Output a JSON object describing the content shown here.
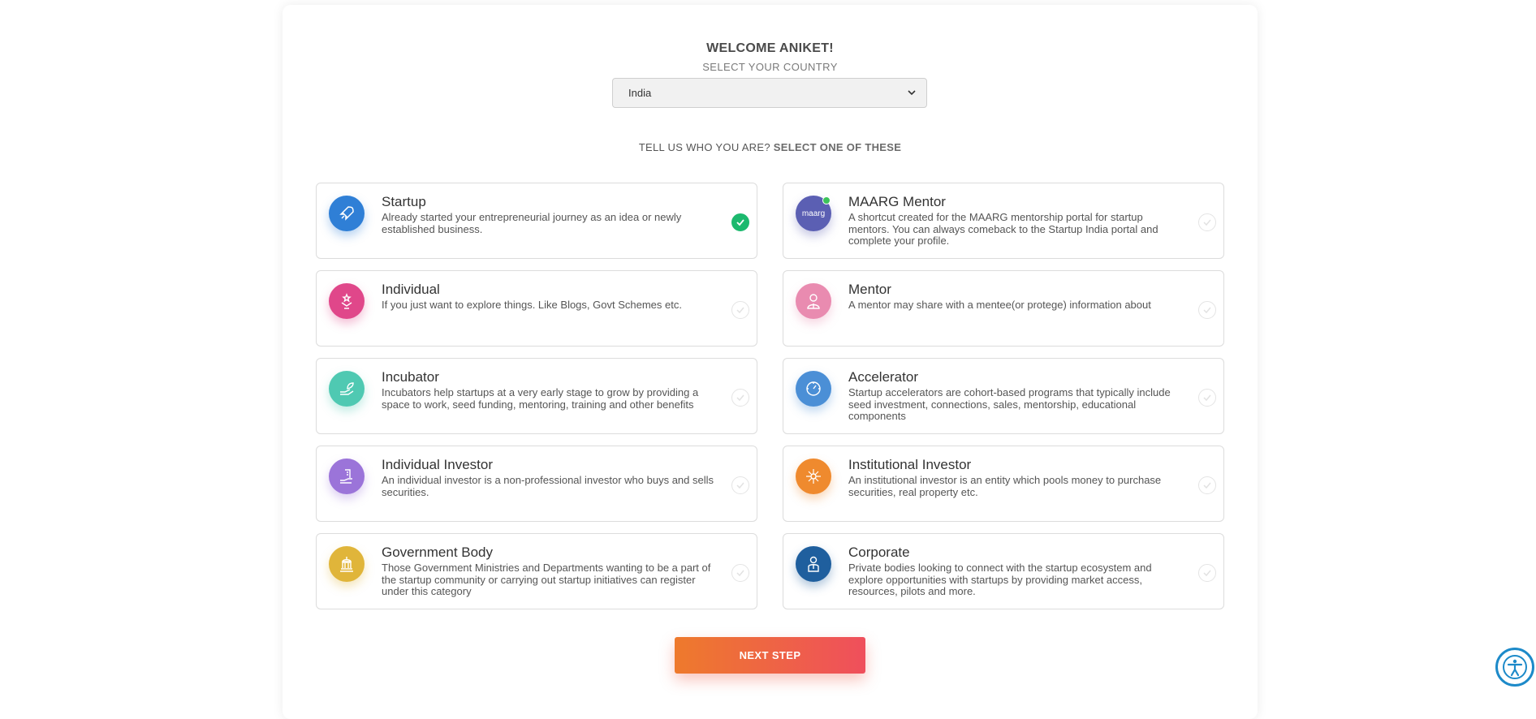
{
  "header": {
    "welcome": "WELCOME ANIKET!",
    "select_country": "SELECT YOUR COUNTRY"
  },
  "country": {
    "value": "India"
  },
  "prompt": {
    "lead": "TELL US WHO YOU ARE?",
    "emphasis": "SELECT ONE OF THESE"
  },
  "options": [
    {
      "title": "Startup",
      "desc": "Already started your entrepreneurial journey as an idea or newly established business.",
      "icon": "rocket-icon",
      "color": "#2f7fd6",
      "selected": true
    },
    {
      "title": "MAARG Mentor",
      "desc": "A shortcut created for the MAARG mentorship portal for startup mentors. You can always comeback to the Startup India portal and complete your profile.",
      "icon": "maarg-logo",
      "logo_text": "maarg",
      "color": "#5b5fb3",
      "selected": false
    },
    {
      "title": "Individual",
      "desc": "If you just want to explore things. Like Blogs, Govt Schemes etc.",
      "icon": "person-star-icon",
      "color": "#e0478a",
      "selected": false
    },
    {
      "title": "Mentor",
      "desc": "A mentor may share with a mentee(or protege) information about",
      "icon": "mentor-icon",
      "color": "#e98bb0",
      "selected": false
    },
    {
      "title": "Incubator",
      "desc": "Incubators help startups at a very early stage to grow by providing a space to work, seed funding, mentoring, training and other benefits",
      "icon": "plant-hand-icon",
      "color": "#4fc9b2",
      "selected": false
    },
    {
      "title": "Accelerator",
      "desc": "Startup accelerators are cohort-based programs that typically include seed investment, connections, sales, mentorship, educational components",
      "icon": "speedometer-icon",
      "color": "#4b8fd6",
      "selected": false
    },
    {
      "title": "Individual Investor",
      "desc": "An individual investor is a non-professional investor who buys and sells securities.",
      "icon": "hand-building-icon",
      "color": "#9b74d9",
      "selected": false
    },
    {
      "title": "Institutional Investor",
      "desc": "An institutional investor is an entity which pools money to purchase securities, real property etc.",
      "icon": "network-icon",
      "color": "#ef8a2e",
      "selected": false
    },
    {
      "title": "Government Body",
      "desc": "Those Government Ministries and Departments wanting to be a part of the startup community or carrying out startup initiatives can register under this category",
      "icon": "government-building-icon",
      "color": "#e0b53a",
      "selected": false
    },
    {
      "title": "Corporate",
      "desc": "Private bodies looking to connect with the startup ecosystem and explore opportunities with startups by providing market access, resources, pilots and more.",
      "icon": "corporate-person-icon",
      "color": "#1f5f9e",
      "selected": false
    }
  ],
  "next_button": {
    "label": "NEXT STEP"
  },
  "colors": {
    "accent_start": "#ee7a2c",
    "accent_end": "#ef4f5c",
    "check": "#1cb96e"
  }
}
